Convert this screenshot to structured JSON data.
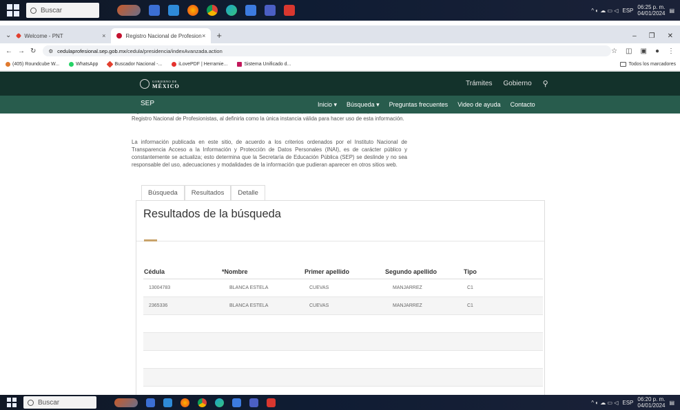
{
  "taskbar": {
    "search_placeholder": "Buscar",
    "top_clock": {
      "time": "06:25 p. m.",
      "date": "04/01/2024"
    },
    "bottom_clock": {
      "time": "06:20 p. m.",
      "date": "04/01/2024"
    },
    "lang": "ESP",
    "app_icons": [
      "fox-icon",
      "calendar-icon",
      "mail-icon",
      "firefox-icon",
      "chrome-icon",
      "edge-icon",
      "store-icon",
      "teams-icon",
      "pdf-icon"
    ]
  },
  "browser": {
    "tabs": [
      {
        "label": "Welcome - PNT",
        "active": false
      },
      {
        "label": "Registro Nacional de Profesion",
        "active": true
      }
    ],
    "url_host": "cedulaprofesional.sep.gob.mx",
    "url_path": "/cedula/presidencia/indexAvanzada.action",
    "bookmarks": [
      "(405) Roundcube W...",
      "WhatsApp",
      "Buscador Nacional -...",
      "iLovePDF | Herramie...",
      "Sistema Unificado d..."
    ],
    "bookmarks_folder": "Todos los marcadores",
    "colors": {
      "tabs_bg": "#dfe3eb"
    }
  },
  "site": {
    "gov_logo_small": "GOBIERNO DE",
    "gov_logo_big": "MÉXICO",
    "gov_links": [
      "Trámites",
      "Gobierno"
    ],
    "sep_title": "SEP",
    "nav": [
      "Inicio",
      "Búsqueda",
      "Preguntas frecuentes",
      "Video de ayuda",
      "Contacto"
    ],
    "colors": {
      "gov_header": "#13322b",
      "sep_header": "#285c4d",
      "accent": "#c8a36a"
    }
  },
  "content": {
    "para1": "registrados títulos y cuenten con cédula profesional con efectos de patente, esto define la responsabilidad del Registro Nacional de Profesionistas, al definirla como la única instancia válida para hacer uso de esta información.",
    "para2": "La información publicada en este sitio, de acuerdo a los criterios ordenados por el Instituto Nacional de Transparencia Acceso a la Información y Protección de Datos Personales (INAI), es de carácter público y constantemente se actualiza; esto determina que la Secretaría de Educación Pública (SEP) se deslinde y no sea responsable del uso, adecuaciones y modalidades de la información que pudieran aparecer en otros sitios web.",
    "subtabs": [
      "Búsqueda",
      "Resultados",
      "Detalle"
    ],
    "panel_title": "Resultados de la búsqueda",
    "table": {
      "headers": [
        "Cédula",
        "*Nombre",
        "Primer apellido",
        "Segundo apellido",
        "Tipo"
      ],
      "rows": [
        [
          "13004783",
          "BLANCA ESTELA",
          "CUEVAS",
          "MANJARREZ",
          "C1"
        ],
        [
          "2365336",
          "BLANCA ESTELA",
          "CUEVAS",
          "MANJARREZ",
          "C1"
        ]
      ]
    }
  }
}
